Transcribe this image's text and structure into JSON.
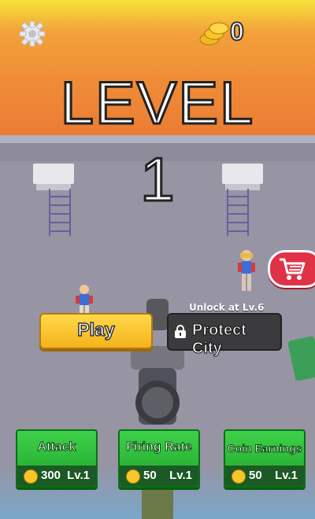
{
  "hud": {
    "coins": "0"
  },
  "level": {
    "word": "LEVEL",
    "number": "1"
  },
  "modes": {
    "play_label": "Play",
    "protect_label": "Protect City",
    "unlock_text": "Unlock at Lv.6"
  },
  "upgrades": [
    {
      "title": "Attack",
      "cost": "300",
      "level": "Lv.1"
    },
    {
      "title": "Firing Rate",
      "cost": "50",
      "level": "Lv.1"
    },
    {
      "title": "Coin Earnings",
      "cost": "50",
      "level": "Lv.1"
    }
  ],
  "icons": {
    "settings": "gear-icon",
    "coins": "coin-stack-icon",
    "shop": "cart-icon",
    "locked": "lock-icon"
  },
  "colors": {
    "play_button": "#f5b31c",
    "shop_button": "#e03246",
    "upgrade_button": "#1ea32a",
    "locked_button": "#3b3b3d"
  }
}
